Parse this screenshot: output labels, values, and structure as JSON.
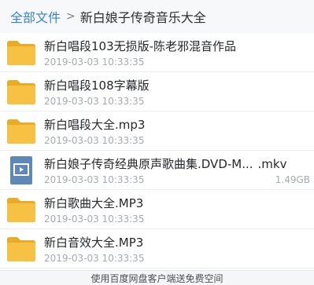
{
  "breadcrumb": {
    "root": "全部文件",
    "separator": ">",
    "current": "新白娘子传奇音乐大全"
  },
  "files": [
    {
      "icon": "folder-icon",
      "name": "新白唱段103无损版-陈老邪混音作品",
      "ext": "",
      "date": "2019-03-03  10:33:35",
      "size": ""
    },
    {
      "icon": "folder-icon",
      "name": "新白唱段108字幕版",
      "ext": "",
      "date": "2019-03-03  10:33:35",
      "size": ""
    },
    {
      "icon": "folder-icon",
      "name": "新白唱段大全.mp3",
      "ext": "",
      "date": "2019-03-03  10:33:35",
      "size": ""
    },
    {
      "icon": "video-file-icon",
      "name": "新白娘子传奇经典原声歌曲集.DVD-M...",
      "ext": ".mkv",
      "date": "2019-03-03  10:33:35",
      "size": "1.49GB"
    },
    {
      "icon": "folder-icon",
      "name": "新白歌曲大全.MP3",
      "ext": "",
      "date": "2019-03-03  10:33:35",
      "size": ""
    },
    {
      "icon": "folder-icon",
      "name": "新白音效大全.MP3",
      "ext": "",
      "date": "2019-03-03  10:33:35",
      "size": ""
    }
  ],
  "footer": {
    "text": "使用百度网盘客户端送免费空间"
  },
  "colors": {
    "accent": "#3a80d9",
    "folder": "#f7c243",
    "video_icon": "#5f88b8"
  }
}
